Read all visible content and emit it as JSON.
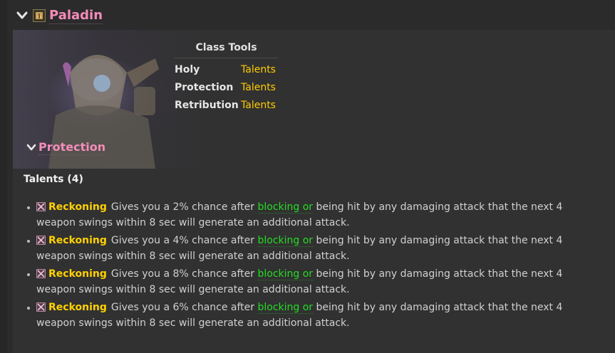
{
  "header": {
    "class_name": "Paladin",
    "class_color": "#f48cba"
  },
  "class_tools": {
    "title": "Class Tools",
    "rows": [
      {
        "spec": "Holy",
        "link": "Talents"
      },
      {
        "spec": "Protection",
        "link": "Talents"
      },
      {
        "spec": "Retribution",
        "link": "Talents"
      }
    ]
  },
  "section": {
    "title": "Protection"
  },
  "talents_heading": "Talents (4)",
  "talents": [
    {
      "name": "Reckoning",
      "pre": "Gives you a 2% chance after ",
      "highlight": "blocking or",
      "post": " being hit by any damaging attack that the next 4 weapon swings within 8 sec will generate an additional attack."
    },
    {
      "name": "Reckoning",
      "pre": "Gives you a 4% chance after ",
      "highlight": "blocking or",
      "post": " being hit by any damaging attack that the next 4 weapon swings within 8 sec will generate an additional attack."
    },
    {
      "name": "Reckoning",
      "pre": "Gives you a 8% chance after ",
      "highlight": "blocking or",
      "post": " being hit by any damaging attack that the next 4 weapon swings within 8 sec will generate an additional attack."
    },
    {
      "name": "Reckoning",
      "pre": "Gives you a 6% chance after ",
      "highlight": "blocking or",
      "post": " being hit by any damaging attack that the next 4 weapon swings within 8 sec will generate an additional attack."
    }
  ],
  "colors": {
    "talent_name": "#ffd100",
    "highlight": "#22dd22",
    "link": "#ffcc00"
  }
}
